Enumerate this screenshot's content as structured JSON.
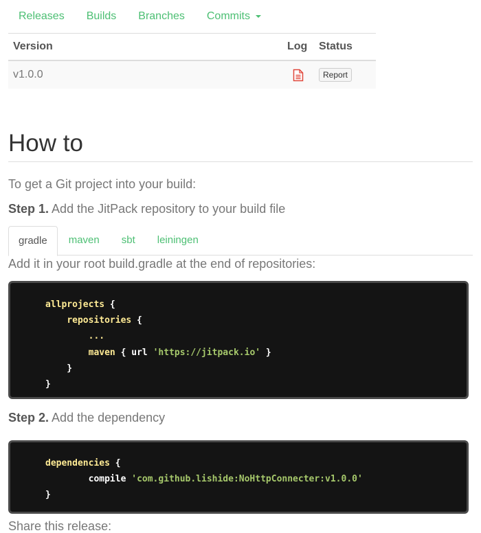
{
  "nav": {
    "items": [
      "Releases",
      "Builds",
      "Branches",
      "Commits"
    ],
    "caret_icon": "caret-down-icon"
  },
  "releases_table": {
    "headers": [
      "Version",
      "Log",
      "Status"
    ],
    "rows": [
      {
        "version": "v1.0.0",
        "log_icon": "document-icon",
        "status_button": "Report"
      }
    ]
  },
  "howto": {
    "title": "How to",
    "intro": "To get a Git project into your build:",
    "step1": {
      "label": "Step 1.",
      "text": "Add the JitPack repository to your build file"
    },
    "tabs": [
      "gradle",
      "maven",
      "sbt",
      "leiningen"
    ],
    "active_tab": "gradle",
    "instruction": "Add it in your root build.gradle at the end of repositories:",
    "code1": {
      "allprojects": "allprojects",
      "repositories": "repositories",
      "ellipsis": "...",
      "maven": "maven",
      "url_key": "url",
      "url_value": "'https://jitpack.io'"
    },
    "step2": {
      "label": "Step 2.",
      "text": "Add the dependency"
    },
    "code2": {
      "dependencies": "dependencies",
      "compile": "compile",
      "artifact": "'com.github.lishide:NoHttpConnecter:v1.0.0'"
    },
    "trailing": "Share this release:"
  },
  "colors": {
    "accent_green": "#4cbf73",
    "code_background": "#141414",
    "code_keyword": "#ffeb95",
    "code_string": "#a6c86b",
    "log_icon": "#e0463a"
  }
}
